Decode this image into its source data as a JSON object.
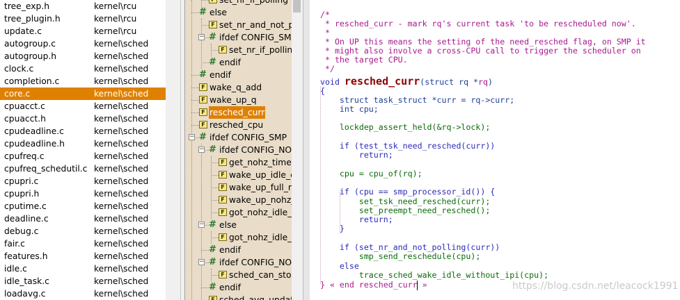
{
  "files": [
    {
      "name": "tree_exp.h",
      "path": "kernel\\rcu"
    },
    {
      "name": "tree_plugin.h",
      "path": "kernel\\rcu"
    },
    {
      "name": "update.c",
      "path": "kernel\\rcu"
    },
    {
      "name": "autogroup.c",
      "path": "kernel\\sched"
    },
    {
      "name": "autogroup.h",
      "path": "kernel\\sched"
    },
    {
      "name": "clock.c",
      "path": "kernel\\sched"
    },
    {
      "name": "completion.c",
      "path": "kernel\\sched"
    },
    {
      "name": "core.c",
      "path": "kernel\\sched"
    },
    {
      "name": "cpuacct.c",
      "path": "kernel\\sched"
    },
    {
      "name": "cpuacct.h",
      "path": "kernel\\sched"
    },
    {
      "name": "cpudeadline.c",
      "path": "kernel\\sched"
    },
    {
      "name": "cpudeadline.h",
      "path": "kernel\\sched"
    },
    {
      "name": "cpufreq.c",
      "path": "kernel\\sched"
    },
    {
      "name": "cpufreq_schedutil.c",
      "path": "kernel\\sched"
    },
    {
      "name": "cpupri.c",
      "path": "kernel\\sched"
    },
    {
      "name": "cpupri.h",
      "path": "kernel\\sched"
    },
    {
      "name": "cputime.c",
      "path": "kernel\\sched"
    },
    {
      "name": "deadline.c",
      "path": "kernel\\sched"
    },
    {
      "name": "debug.c",
      "path": "kernel\\sched"
    },
    {
      "name": "fair.c",
      "path": "kernel\\sched"
    },
    {
      "name": "features.h",
      "path": "kernel\\sched"
    },
    {
      "name": "idle.c",
      "path": "kernel\\sched"
    },
    {
      "name": "idle_task.c",
      "path": "kernel\\sched"
    },
    {
      "name": "loadavg.c",
      "path": "kernel\\sched"
    }
  ],
  "selected_file": "core.c",
  "tree": [
    {
      "label": "set_nr_if_polling",
      "kind": "func"
    },
    {
      "label": "else",
      "kind": "hash"
    },
    {
      "label": "set_nr_and_not_polling",
      "kind": "func"
    },
    {
      "label": "ifdef CONFIG_SMP",
      "kind": "hash"
    },
    {
      "label": "set_nr_if_polling",
      "kind": "func"
    },
    {
      "label": "endif",
      "kind": "hash"
    },
    {
      "label": "endif",
      "kind": "hash"
    },
    {
      "label": "wake_q_add",
      "kind": "func"
    },
    {
      "label": "wake_up_q",
      "kind": "func"
    },
    {
      "label": "resched_curr",
      "kind": "func"
    },
    {
      "label": "resched_cpu",
      "kind": "func"
    },
    {
      "label": "ifdef CONFIG_SMP",
      "kind": "hash"
    },
    {
      "label": "ifdef CONFIG_NO_HZ_COMMON",
      "kind": "hash"
    },
    {
      "label": "get_nohz_timer_target",
      "kind": "func"
    },
    {
      "label": "wake_up_idle_cpu",
      "kind": "func"
    },
    {
      "label": "wake_up_full_nohz_cpu",
      "kind": "func"
    },
    {
      "label": "wake_up_nohz_target",
      "kind": "func"
    },
    {
      "label": "got_nohz_idle_kick",
      "kind": "func"
    },
    {
      "label": "else",
      "kind": "hash"
    },
    {
      "label": "got_nohz_idle_kick",
      "kind": "func"
    },
    {
      "label": "endif",
      "kind": "hash"
    },
    {
      "label": "ifdef CONFIG_NO_HZ_FULL",
      "kind": "hash"
    },
    {
      "label": "sched_can_stop_tick",
      "kind": "func"
    },
    {
      "label": "endif",
      "kind": "hash"
    },
    {
      "label": "sched_avg_update",
      "kind": "func"
    }
  ],
  "selected_tree_item": "resched_curr",
  "code": {
    "c1": "/*",
    "c2": " * resched_curr - mark rq's current task 'to be rescheduled now'.",
    "c3": " *",
    "c4": " * On UP this means the setting of the need_resched flag, on SMP it",
    "c5": " * might also involve a cross-CPU call to trigger the scheduler on",
    "c6": " * the target CPU.",
    "c7": " */",
    "l8_kw": "void ",
    "l8_fn": "resched_curr",
    "l8_a": "(struct rq *",
    "l8_b": "rq",
    "l8_c": ")",
    "l9": "{",
    "l10": "    struct task_struct *curr = rq->curr;",
    "l11": "    int cpu;",
    "l12": "    lockdep_assert_held(&rq->lock);",
    "l13": "    if (test_tsk_need_resched(curr))",
    "l14": "        return;",
    "l15": "    cpu = cpu_of(rq);",
    "l16": "    if (cpu == smp_processor_id()) {",
    "l17": "        set_tsk_need_resched(curr);",
    "l18": "        set_preempt_need_resched();",
    "l19": "        return;",
    "l20": "    }",
    "l21": "    if (set_nr_and_not_polling(curr))",
    "l22": "        smp_send_reschedule(cpu);",
    "l23": "    else",
    "l24": "        trace_sched_wake_idle_without_ipi(cpu);",
    "l25": "} « end resched_curr » "
  },
  "watermark": "https://blog.csdn.net/leacock1991",
  "colors": {
    "selection": "#e08000",
    "tree_bg": "#e9dcc8",
    "comment": "#a8198f",
    "function_name": "#8b0000"
  }
}
